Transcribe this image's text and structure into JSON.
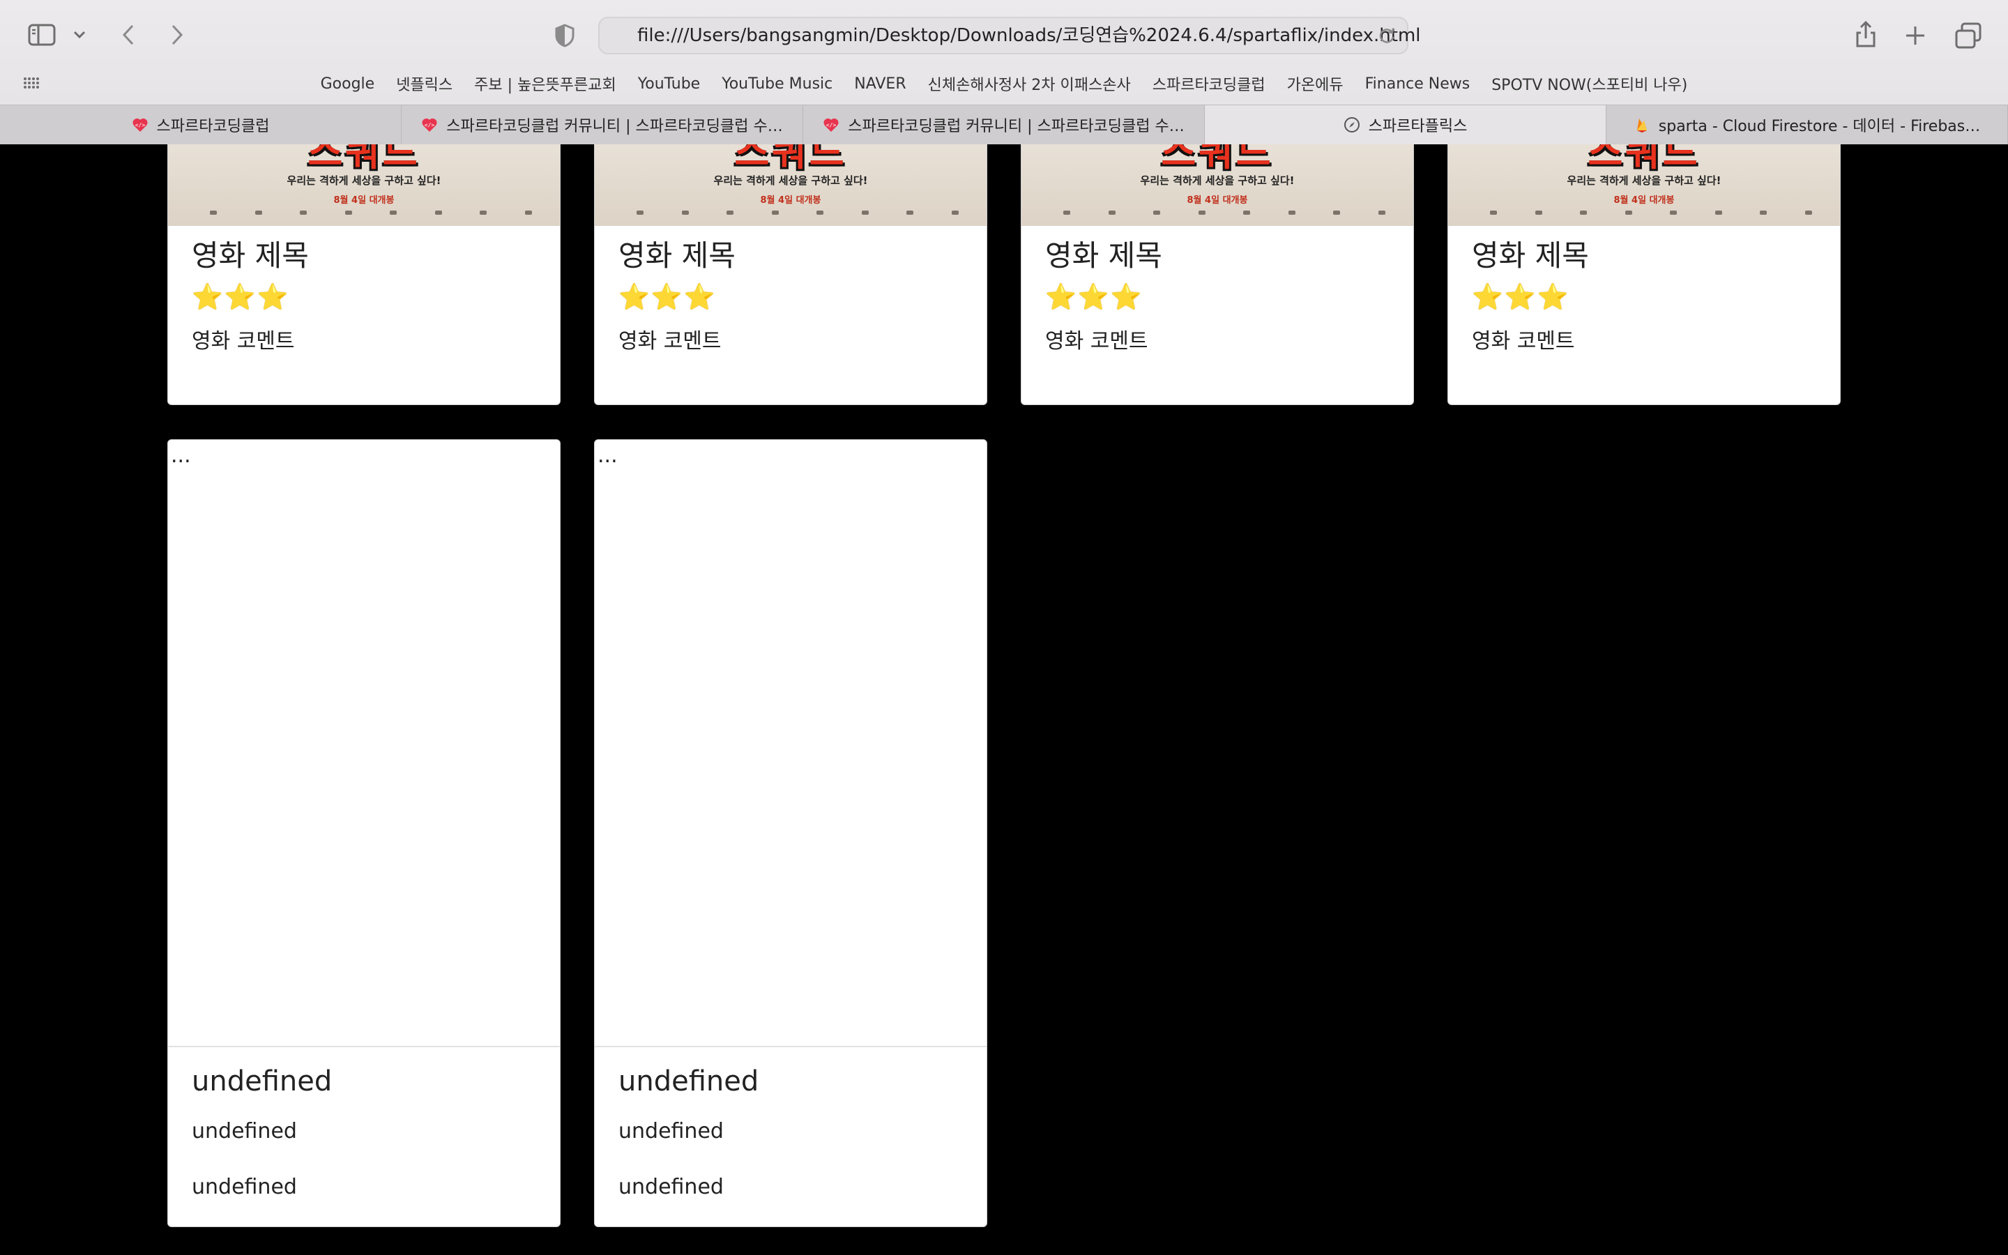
{
  "browser": {
    "url": "file:///Users/bangsangmin/Desktop/Downloads/코딩연습%2024.6.4/spartaflix/index.html",
    "favorites": [
      "Google",
      "넷플릭스",
      "주보 | 높은뜻푸른교회",
      "YouTube",
      "YouTube Music",
      "NAVER",
      "신체손해사정사 2차 이패스손사",
      "스파르타코딩클럽",
      "가온에듀",
      "Finance News",
      "SPOTV NOW(스포티비 나우)"
    ],
    "tabs": [
      {
        "label": "스파르타코딩클럽",
        "icon": "sparta-favicon",
        "active": false
      },
      {
        "label": "스파르타코딩클럽 커뮤니티 | 스파르타코딩클럽 수…",
        "icon": "sparta-favicon",
        "active": false
      },
      {
        "label": "스파르타코딩클럽 커뮤니티 | 스파르타코딩클럽 수…",
        "icon": "sparta-favicon",
        "active": false
      },
      {
        "label": "스파르타플릭스",
        "icon": "compass-icon",
        "active": true
      },
      {
        "label": "sparta - Cloud Firestore - 데이터 - Firebas…",
        "icon": "firebase-icon",
        "active": false
      }
    ]
  },
  "poster": {
    "title": "스쿼드",
    "tagline": "우리는 격하게 세상을 구하고 싶다!",
    "date": "8월 4일 대개봉"
  },
  "movie_cards": [
    {
      "title": "영화 제목",
      "stars": "⭐⭐⭐",
      "comment": "영화 코멘트"
    },
    {
      "title": "영화 제목",
      "stars": "⭐⭐⭐",
      "comment": "영화 코멘트"
    },
    {
      "title": "영화 제목",
      "stars": "⭐⭐⭐",
      "comment": "영화 코멘트"
    },
    {
      "title": "영화 제목",
      "stars": "⭐⭐⭐",
      "comment": "영화 코멘트"
    }
  ],
  "undefined_cards": [
    {
      "alt": "...",
      "title": "undefined",
      "line1": "undefined",
      "line2": "undefined"
    },
    {
      "alt": "...",
      "title": "undefined",
      "line1": "undefined",
      "line2": "undefined"
    }
  ],
  "colors": {
    "page_bg": "#000000",
    "card_bg": "#ffffff",
    "poster_accent": "#e8321e",
    "star": "#f4c224"
  }
}
